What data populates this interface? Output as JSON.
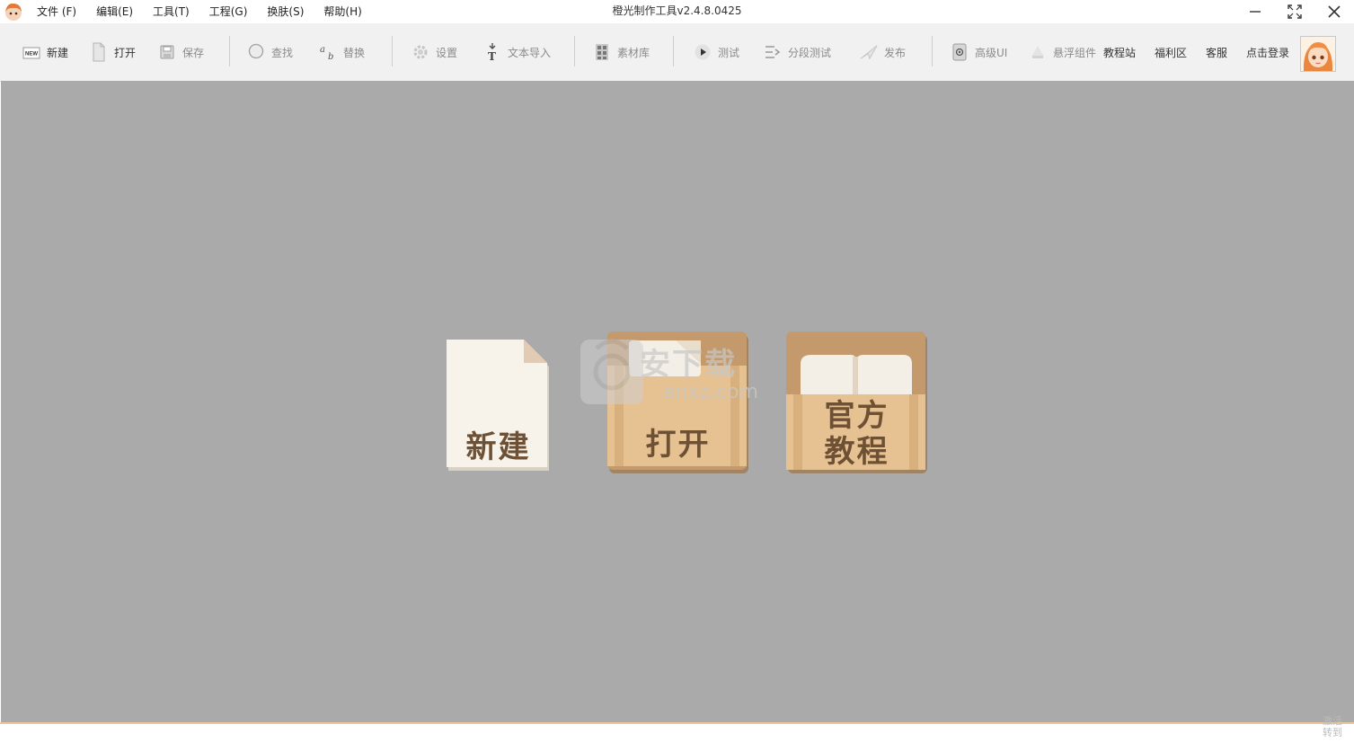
{
  "window": {
    "title": "橙光制作工具v2.4.8.0425"
  },
  "menu": {
    "items": [
      {
        "label": "文件 (F)"
      },
      {
        "label": "编辑(E)"
      },
      {
        "label": "工具(T)"
      },
      {
        "label": "工程(G)"
      },
      {
        "label": "换肤(S)"
      },
      {
        "label": "帮助(H)"
      }
    ]
  },
  "toolbar": {
    "new": "新建",
    "open": "打开",
    "save": "保存",
    "find": "查找",
    "replace": "替换",
    "settings": "设置",
    "text_import": "文本导入",
    "assets": "素材库",
    "test": "测试",
    "segment_test": "分段测试",
    "publish": "发布",
    "advanced_ui": "高级UI",
    "float_widget": "悬浮组件",
    "tutorial_site": "教程站",
    "welfare": "福利区",
    "support": "客服",
    "login": "点击登录",
    "new_icon_text": "NEW"
  },
  "start": {
    "new_label": "新建",
    "open_label": "打开",
    "tutorial_line1": "官方",
    "tutorial_line2": "教程"
  },
  "watermark": {
    "text": "安下载",
    "sub": "anxz.com"
  },
  "corner": {
    "line1": "激活",
    "line2": "转到"
  },
  "colors": {
    "workspace": "#aaaaaa",
    "card_brown": "#c49a6c",
    "card_light": "#e6c293",
    "label_brown": "#6e5034",
    "paper": "#f7f3ea"
  }
}
